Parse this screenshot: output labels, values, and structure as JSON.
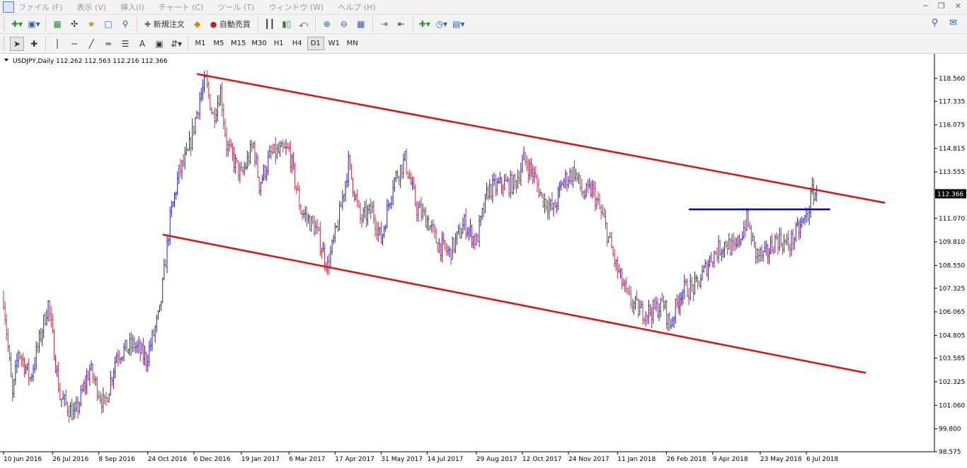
{
  "menu": {
    "items": [
      "ファイル (F)",
      "表示 (V)",
      "挿入(I)",
      "チャート (C)",
      "ツール (T)",
      "ウィンドウ (W)",
      "ヘルプ (H)"
    ]
  },
  "toolbar1": {
    "new_order_label": "新規注文",
    "auto_trade_label": "自動売買"
  },
  "toolbar2": {
    "timeframes": [
      "M1",
      "M5",
      "M15",
      "M30",
      "H1",
      "H4",
      "D1",
      "W1",
      "MN"
    ],
    "active_timeframe": "D1",
    "text_tool_label": "A"
  },
  "colors": {
    "bull": "#1f1fb0",
    "bear": "#c0303a",
    "trendline": "#e01010",
    "level": "#0000cc",
    "axis": "#000000"
  },
  "chart_data": {
    "type": "ohlc",
    "symbol_header": "USDJPY,Daily  112.262 112.563 112.216 112.366",
    "current_price": 112.366,
    "current_price_label": "112.366",
    "ylim": [
      98.575,
      119.2
    ],
    "y_ticks": [
      "118.560",
      "117.335",
      "116.075",
      "114.815",
      "113.555",
      "111.070",
      "109.810",
      "108.550",
      "107.325",
      "106.065",
      "104.805",
      "103.585",
      "102.325",
      "101.060",
      "99.800",
      "98.575"
    ],
    "date_ticks": [
      {
        "label": "10 Jun 2016",
        "bar": 0
      },
      {
        "label": "26 Jul 2016",
        "bar": 33
      },
      {
        "label": "8 Sep 2016",
        "bar": 64
      },
      {
        "label": "24 Oct 2016",
        "bar": 97
      },
      {
        "label": "6 Dec 2016",
        "bar": 128
      },
      {
        "label": "19 Jan 2017",
        "bar": 160
      },
      {
        "label": "6 Mar 2017",
        "bar": 192
      },
      {
        "label": "17 Apr 2017",
        "bar": 223
      },
      {
        "label": "31 May 2017",
        "bar": 254
      },
      {
        "label": "14 Jul 2017",
        "bar": 285
      },
      {
        "label": "29 Aug 2017",
        "bar": 318
      },
      {
        "label": "12 Oct 2017",
        "bar": 349
      },
      {
        "label": "24 Nov 2017",
        "bar": 380
      },
      {
        "label": "11 Jan 2018",
        "bar": 413
      },
      {
        "label": "26 Feb 2018",
        "bar": 446
      },
      {
        "label": "9 Apr 2018",
        "bar": 477
      },
      {
        "label": "23 May 2018",
        "bar": 509
      },
      {
        "label": "6 Jul 2018",
        "bar": 540
      }
    ],
    "bar_count": 548,
    "price_anchors": [
      [
        0,
        106.8
      ],
      [
        6,
        101.5
      ],
      [
        10,
        104.0
      ],
      [
        18,
        102.5
      ],
      [
        30,
        106.5
      ],
      [
        38,
        101.5
      ],
      [
        48,
        100.5
      ],
      [
        58,
        103.0
      ],
      [
        68,
        101.0
      ],
      [
        76,
        103.8
      ],
      [
        88,
        104.3
      ],
      [
        96,
        103.5
      ],
      [
        105,
        106.0
      ],
      [
        112,
        111.0
      ],
      [
        118,
        113.5
      ],
      [
        124,
        114.5
      ],
      [
        132,
        117.5
      ],
      [
        136,
        118.4
      ],
      [
        141,
        116.5
      ],
      [
        146,
        117.9
      ],
      [
        150,
        115.0
      ],
      [
        160,
        113.3
      ],
      [
        168,
        115.0
      ],
      [
        172,
        112.9
      ],
      [
        180,
        114.5
      ],
      [
        192,
        114.7
      ],
      [
        200,
        111.5
      ],
      [
        210,
        110.5
      ],
      [
        218,
        108.5
      ],
      [
        225,
        110.8
      ],
      [
        232,
        114.0
      ],
      [
        240,
        111.0
      ],
      [
        248,
        111.5
      ],
      [
        254,
        109.9
      ],
      [
        262,
        113.0
      ],
      [
        270,
        114.2
      ],
      [
        278,
        111.6
      ],
      [
        285,
        111.0
      ],
      [
        292,
        109.7
      ],
      [
        300,
        109.2
      ],
      [
        310,
        110.8
      ],
      [
        318,
        109.8
      ],
      [
        326,
        112.6
      ],
      [
        336,
        112.9
      ],
      [
        344,
        112.9
      ],
      [
        350,
        114.2
      ],
      [
        356,
        113.5
      ],
      [
        362,
        112.2
      ],
      [
        370,
        111.5
      ],
      [
        376,
        113.0
      ],
      [
        384,
        113.6
      ],
      [
        390,
        112.3
      ],
      [
        396,
        112.6
      ],
      [
        404,
        110.9
      ],
      [
        412,
        108.5
      ],
      [
        420,
        106.8
      ],
      [
        428,
        106.1
      ],
      [
        436,
        106.1
      ],
      [
        444,
        106.5
      ],
      [
        448,
        105.3
      ],
      [
        456,
        107.2
      ],
      [
        466,
        107.4
      ],
      [
        476,
        109.0
      ],
      [
        486,
        109.8
      ],
      [
        492,
        109.3
      ],
      [
        500,
        111.0
      ],
      [
        506,
        109.2
      ],
      [
        512,
        109.0
      ],
      [
        520,
        110.0
      ],
      [
        528,
        109.6
      ],
      [
        536,
        110.6
      ],
      [
        541,
        111.3
      ],
      [
        544,
        112.5
      ],
      [
        547,
        112.366
      ]
    ],
    "trendline_upper": [
      [
        130,
        118.8
      ],
      [
        593,
        111.9
      ]
    ],
    "trendline_lower": [
      [
        107,
        110.2
      ],
      [
        580,
        102.8
      ]
    ],
    "level_line": {
      "price": 111.55,
      "from_bar": 461,
      "to_bar": 556
    }
  }
}
